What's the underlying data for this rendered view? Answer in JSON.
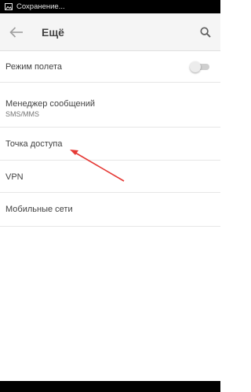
{
  "status_bar": {
    "notification_icon": "image-icon",
    "text": "Сохранение..."
  },
  "toolbar": {
    "back_icon": "arrow-left-icon",
    "title": "Ещё",
    "search_icon": "search-icon"
  },
  "items": [
    {
      "label": "Режим полета",
      "toggle_on": false
    },
    {
      "label": "Менеджер сообщений",
      "sublabel": "SMS/MMS"
    },
    {
      "label": "Точка доступа"
    },
    {
      "label": "VPN"
    },
    {
      "label": "Мобильные сети"
    }
  ],
  "colors": {
    "annotation_arrow": "#e53935",
    "toolbar_bg": "#f5f5f5",
    "status_bar_bg": "#000000"
  }
}
